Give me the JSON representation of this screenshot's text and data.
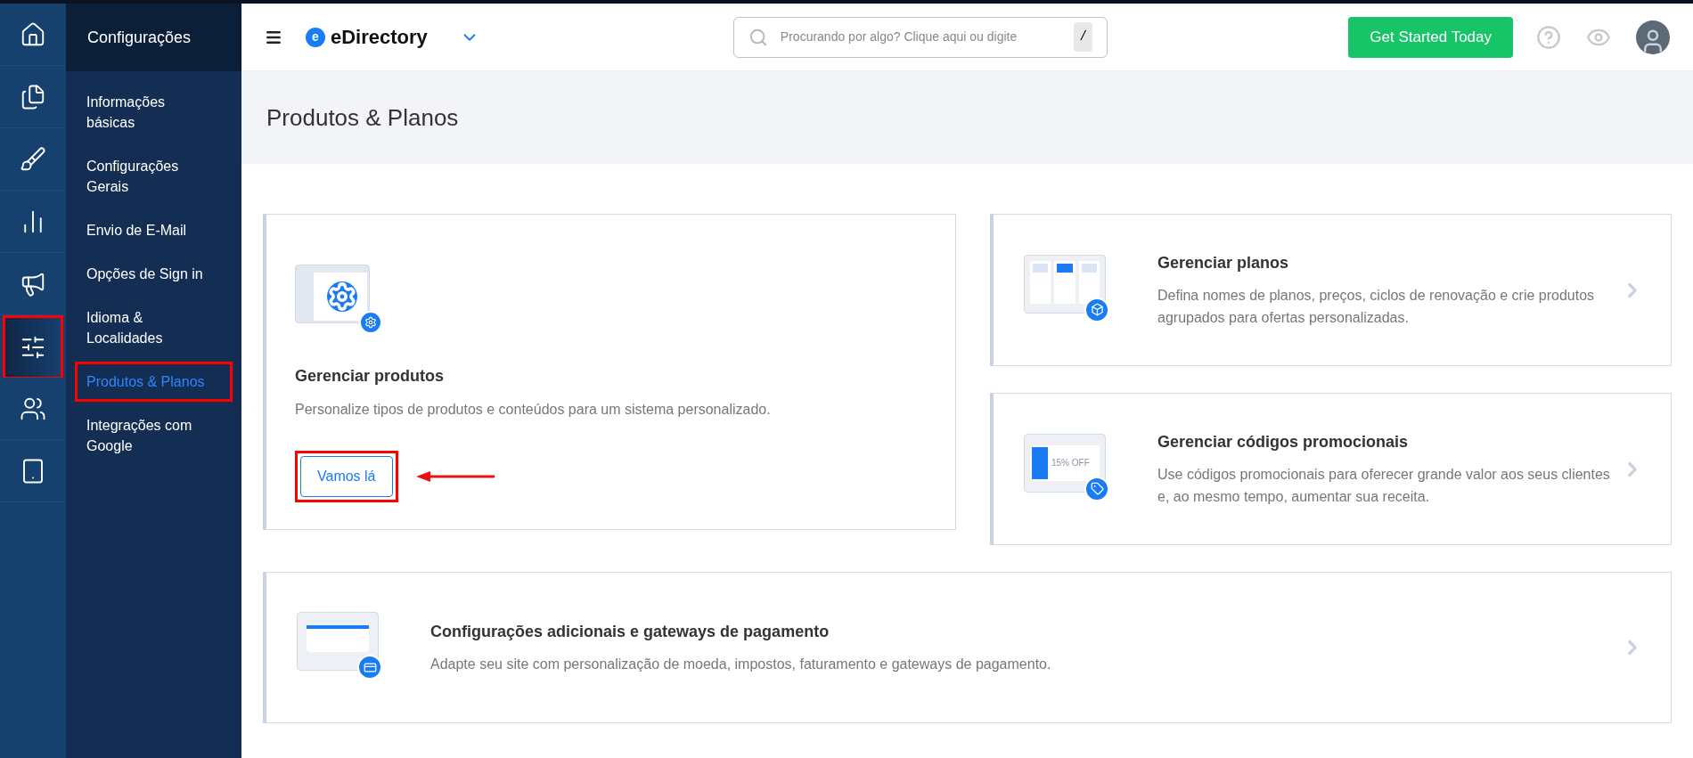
{
  "rail": [
    {
      "selected": false,
      "highlighted": false
    },
    {
      "selected": false,
      "highlighted": false
    },
    {
      "selected": false,
      "highlighted": false
    },
    {
      "selected": false,
      "highlighted": false
    },
    {
      "selected": false,
      "highlighted": false
    },
    {
      "selected": true,
      "highlighted": true
    },
    {
      "selected": false,
      "highlighted": false
    },
    {
      "selected": false,
      "highlighted": false
    }
  ],
  "submenu": {
    "title": "Configurações",
    "items": [
      {
        "label": "Informações básicas",
        "selected": false,
        "highlighted": false
      },
      {
        "label": "Configurações Gerais",
        "selected": false,
        "highlighted": false
      },
      {
        "label": "Envio de E-Mail",
        "selected": false,
        "highlighted": false
      },
      {
        "label": "Opções de Sign in",
        "selected": false,
        "highlighted": false
      },
      {
        "label": "Idioma & Localidades",
        "selected": false,
        "highlighted": false
      },
      {
        "label": "Produtos & Planos",
        "selected": true,
        "highlighted": true
      },
      {
        "label": "Integrações com Google",
        "selected": false,
        "highlighted": false
      }
    ]
  },
  "topbar": {
    "brand": "eDirectory",
    "brand_letter": "e",
    "search": {
      "placeholder": "Procurando por algo? Clique aqui ou digite",
      "shortcut": "/"
    },
    "cta": "Get Started Today"
  },
  "page": {
    "title": "Produtos & Planos"
  },
  "cards": [
    {
      "kind": "stacked",
      "title": "Gerenciar produtos",
      "description": "Personalize tipos de produtos e conteúdos para um sistema personalizado.",
      "button": {
        "label": "Vamos lá",
        "highlighted": true,
        "arrow": true
      }
    },
    {
      "kind": "row",
      "title": "Gerenciar planos",
      "description": "Defina nomes de planos, preços, ciclos de renovação e crie produtos agrupados para ofertas personalizadas."
    },
    {
      "kind": "row",
      "title": "Gerenciar códigos promocionais",
      "description": "Use códigos promocionais para oferecer grande valor aos seus clientes e, ao mesmo tempo, aumentar sua receita.",
      "badge": "15% OFF"
    },
    {
      "kind": "row",
      "title": "Configurações adicionais e gateways de pagamento",
      "description": "Adapte seu site com personalização de moeda, impostos, faturamento e gateways de pagamento."
    }
  ]
}
